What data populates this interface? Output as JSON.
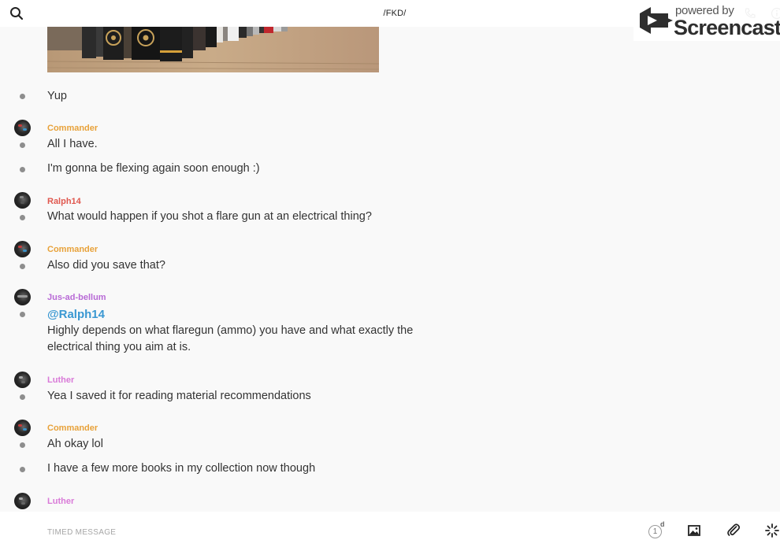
{
  "header": {
    "channel": "/FKD/",
    "search_icon": "search-icon",
    "call_icon": "phone-icon",
    "info_icon": "info-icon"
  },
  "watermark": {
    "powered_by": "powered by",
    "brand": "Screencastify"
  },
  "messages": [
    {
      "text": "Yup"
    },
    {
      "author": "Commander",
      "text": "All I have."
    },
    {
      "text": "I'm gonna be flexing again soon enough :)"
    },
    {
      "author": "Ralph14",
      "text": "What would happen if you shot a flare gun at an electrical thing?"
    },
    {
      "author": "Commander",
      "text": "Also did you save that?"
    },
    {
      "author": "Jus-ad-bellum",
      "mention": "@Ralph14",
      "text_line1": "Highly depends on what flaregun (ammo) you have and what exactly the",
      "text_line2": "electrical thing you aim at is."
    },
    {
      "author": "Luther",
      "text": "Yea I saved it for reading material recommendations"
    },
    {
      "author": "Commander",
      "text": "Ah okay lol"
    },
    {
      "text": "I have a few more books in my collection now though"
    },
    {
      "author": "Luther"
    }
  ],
  "author_colors": {
    "Commander": "#e8a23a",
    "Ralph14": "#e0584f",
    "Jus-ad-bellum": "#b86ad6",
    "Luther": "#d97ad8"
  },
  "composer": {
    "placeholder": "TIMED MESSAGE",
    "timer_value": "1",
    "timer_unit": "d",
    "image_icon": "image-icon",
    "attach_icon": "paperclip-icon",
    "send_icon": "spark-icon"
  }
}
